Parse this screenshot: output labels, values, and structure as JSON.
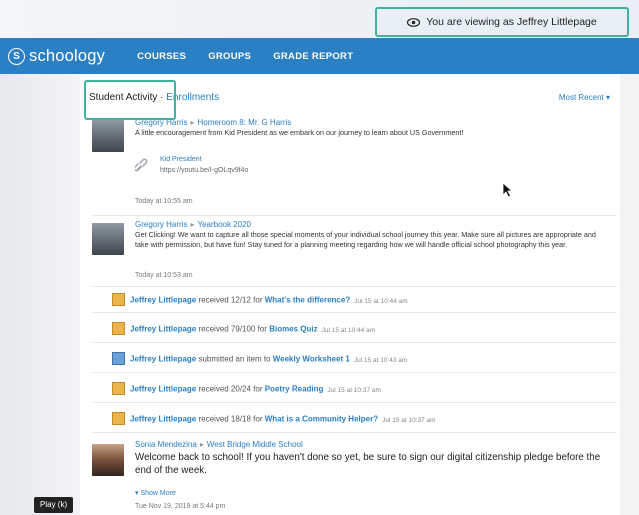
{
  "banner": {
    "text": "You are viewing as Jeffrey Littlepage",
    "icon": "eye-icon"
  },
  "nav": {
    "logo_text": "schoology",
    "logo_mark": "S",
    "links": [
      "COURSES",
      "GROUPS",
      "GRADE REPORT"
    ]
  },
  "feed_header": {
    "title": "Student Activity",
    "separator": " · ",
    "enrollments": "Enrollments",
    "sort": "Most Recent ▾"
  },
  "posts": [
    {
      "author": "Gregory Harris",
      "target": "Homeroom 8: Mr. G Harris",
      "body": "A little encouragement from Kid President as we embark on our journey to learn about US Government!",
      "link_title": "Kid President",
      "link_url": "https://youtu.be/I-gOLqv9f4o",
      "time": "Today at 10:55 am"
    },
    {
      "author": "Gregory Harris",
      "target": "Yearbook 2020",
      "body": "Get Clicking! We want to capture all those special moments of your individual school journey this year.  Make sure all pictures are appropriate and take with permission, but have fun! Stay tuned for a planning meeting regarding how we will handle official school photography this year.",
      "time": "Today at 10:53 am"
    }
  ],
  "activity": [
    {
      "who": "Jeffrey Littlepage",
      "what": " received 12/12 for ",
      "item": "What's the difference?",
      "when": "Jul 15 at 10:44 am",
      "icon": "assignment-icon"
    },
    {
      "who": "Jeffrey Littlepage",
      "what": " received 79/100 for ",
      "item": "Biomes Quiz",
      "when": "Jul 15 at 10:44 am",
      "icon": "assignment-icon"
    },
    {
      "who": "Jeffrey Littlepage",
      "what": " submitted an item to ",
      "item": "Weekly Worksheet 1",
      "when": "Jul 15 at 10:43 am",
      "icon": "submission-icon"
    },
    {
      "who": "Jeffrey Littlepage",
      "what": " received 20/24 for ",
      "item": "Poetry Reading",
      "when": "Jul 15 at 10:37 am",
      "icon": "assignment-icon"
    },
    {
      "who": "Jeffrey Littlepage",
      "what": " received 18/18 for ",
      "item": "What is a Community Helper?",
      "when": "Jul 15 at 10:37 am",
      "icon": "assignment-icon"
    }
  ],
  "last_post": {
    "author": "Sonia Mendezina",
    "target": "West Bridge Middle School",
    "body": "Welcome back to school! If you haven't done so yet, be sure to sign our digital citizenship pledge before the end of the week.",
    "show_more": "Show More",
    "time": "Tue Nov 19, 2019 at 5:44 pm"
  },
  "video_tip": "Play (k)",
  "colors": {
    "brand": "#2b7fc3",
    "highlight": "#3fb3a0"
  }
}
